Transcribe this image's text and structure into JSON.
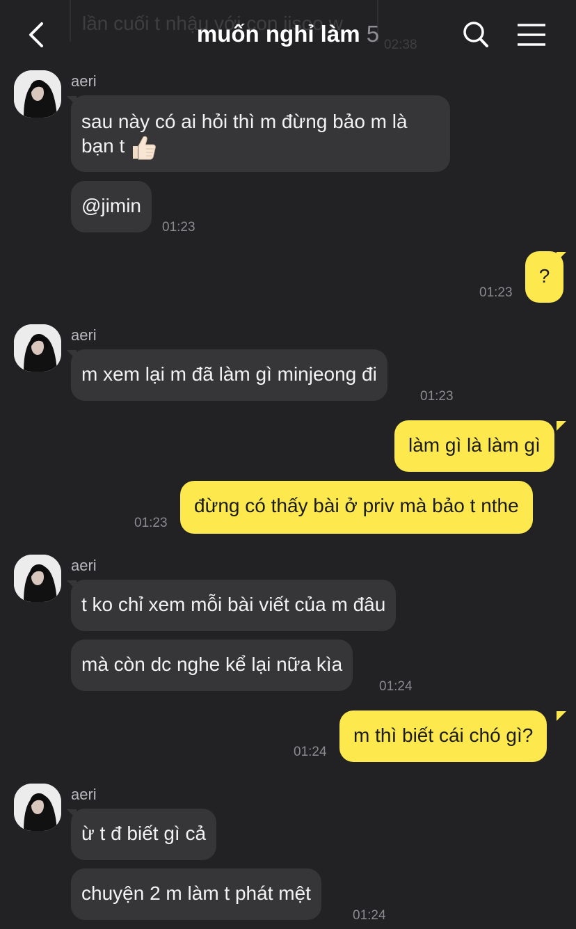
{
  "header": {
    "title": "muốn nghỉ làm",
    "member_count": "5",
    "previous_message_text": "lần cuối t nhậu với con jisoo w ",
    "previous_message_time": "02:38"
  },
  "messages": [
    {
      "sender": "aeri",
      "text": "sau này có ai hỏi thì m đừng bảo m là bạn t",
      "emoji": "thumbs-up"
    },
    {
      "text": "@jimin",
      "time": "01:23"
    },
    {
      "from_me": true,
      "text": "?",
      "time": "01:23"
    },
    {
      "sender": "aeri",
      "text": "m xem lại m đã làm gì minjeong đi",
      "time": "01:23"
    },
    {
      "from_me": true,
      "text": "làm gì là làm gì"
    },
    {
      "from_me": true,
      "text": "đừng có thấy bài ở priv mà bảo t nthe",
      "time": "01:23"
    },
    {
      "sender": "aeri",
      "text": "t ko chỉ xem mỗi bài viết của m đâu"
    },
    {
      "text": "mà còn dc nghe kể lại nữa kìa",
      "time": "01:24"
    },
    {
      "from_me": true,
      "text": "m thì biết cái chó gì?",
      "time": "01:24"
    },
    {
      "sender": "aeri",
      "text": "ừ t đ biết gì cả"
    },
    {
      "text": "chuyện 2 m làm t phát mệt",
      "time": "01:24"
    }
  ],
  "colors": {
    "background": "#222224",
    "other_bubble": "#363639",
    "my_bubble": "#fde84d",
    "timestamp": "#8b8b8f"
  }
}
